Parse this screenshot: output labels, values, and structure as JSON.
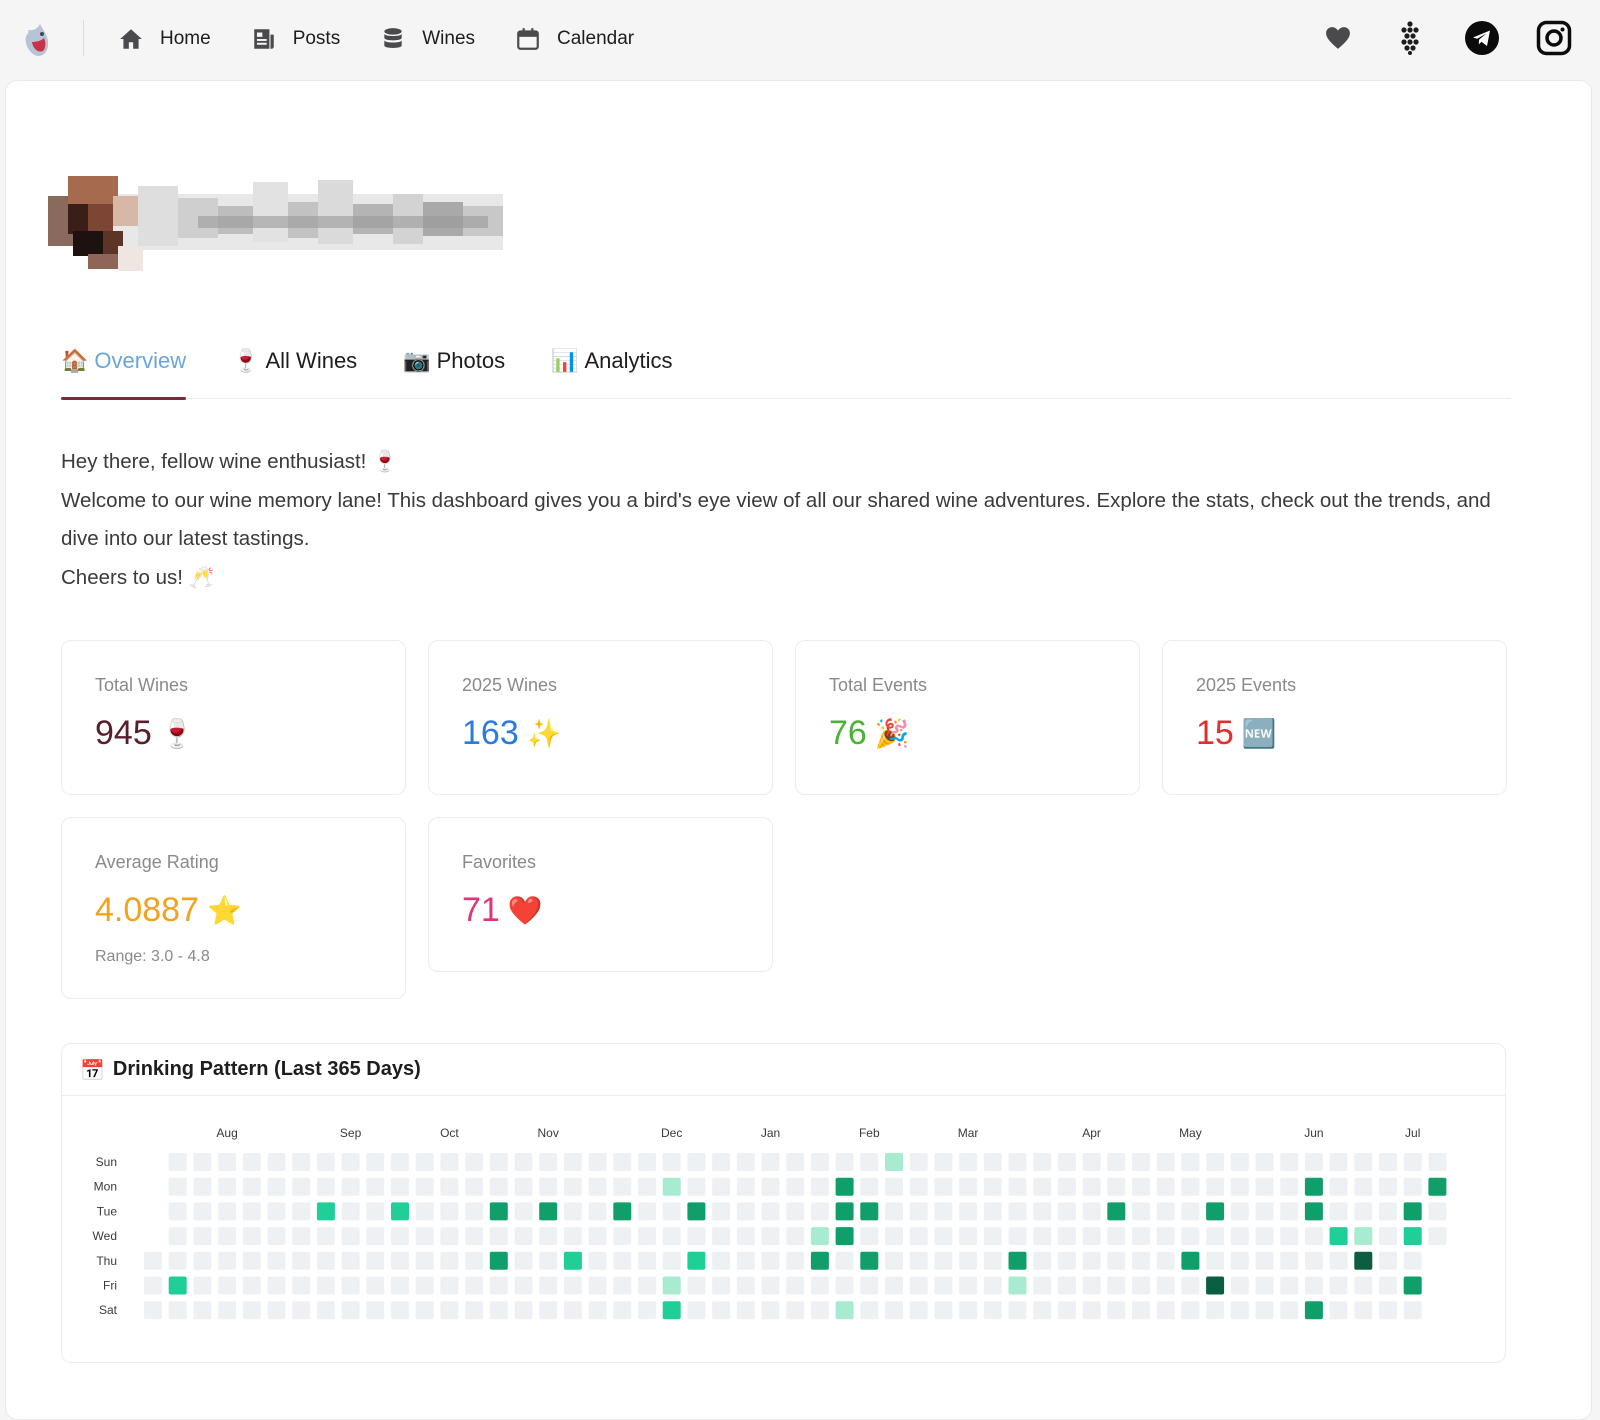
{
  "nav": {
    "links": [
      {
        "label": "Home",
        "icon": "home-icon"
      },
      {
        "label": "Posts",
        "icon": "posts-icon"
      },
      {
        "label": "Wines",
        "icon": "database-icon"
      },
      {
        "label": "Calendar",
        "icon": "calendar-icon"
      }
    ],
    "right_icons": [
      "heart-icon",
      "grapes-icon",
      "telegram-icon",
      "instagram-icon"
    ]
  },
  "tabs": [
    {
      "emoji": "🏠",
      "label": "Overview",
      "active": true
    },
    {
      "emoji": "🍷",
      "label": "All Wines",
      "active": false
    },
    {
      "emoji": "📷",
      "label": "Photos",
      "active": false
    },
    {
      "emoji": "📊",
      "label": "Analytics",
      "active": false
    }
  ],
  "intro": {
    "line1": "Hey there, fellow wine enthusiast! 🍷",
    "line2": "Welcome to our wine memory lane! This dashboard gives you a bird's eye view of all our shared wine adventures. Explore the stats, check out the trends, and dive into our latest tastings.",
    "line3": "Cheers to us! 🥂"
  },
  "stats": {
    "total_wines": {
      "label": "Total Wines",
      "value": "945",
      "emoji": "🍷",
      "color": "#5a1e2a"
    },
    "wines_2025": {
      "label": "2025 Wines",
      "value": "163",
      "emoji": "✨",
      "color": "#2a7be0"
    },
    "total_events": {
      "label": "Total Events",
      "value": "76",
      "emoji": "🎉",
      "color": "#4cb233"
    },
    "events_2025": {
      "label": "2025 Events",
      "value": "15",
      "emoji": "🆕",
      "color": "#e02f2f"
    },
    "avg_rating": {
      "label": "Average Rating",
      "value": "4.0887",
      "emoji": "⭐",
      "color": "#f2a21b",
      "range": "Range: 3.0 - 4.8"
    },
    "favorites": {
      "label": "Favorites",
      "value": "71",
      "emoji": "❤️",
      "color": "#e0357a"
    }
  },
  "heatmap": {
    "title": "Drinking Pattern (Last 365 Days)",
    "emoji": "📅",
    "day_labels": [
      "Sun",
      "Mon",
      "Tue",
      "Wed",
      "Thu",
      "Fri",
      "Sat"
    ],
    "months": [
      {
        "label": "Aug",
        "week": 3
      },
      {
        "label": "Sep",
        "week": 8
      },
      {
        "label": "Oct",
        "week": 12
      },
      {
        "label": "Nov",
        "week": 16
      },
      {
        "label": "Dec",
        "week": 21
      },
      {
        "label": "Jan",
        "week": 25
      },
      {
        "label": "Feb",
        "week": 29
      },
      {
        "label": "Mar",
        "week": 33
      },
      {
        "label": "Apr",
        "week": 38
      },
      {
        "label": "May",
        "week": 42
      },
      {
        "label": "Jun",
        "week": 47
      },
      {
        "label": "Jul",
        "week": 51
      }
    ],
    "weeks": 53,
    "colors": [
      "#eef1f4",
      "#a7ecd0",
      "#1fcf97",
      "#109e6a",
      "#0c5e41"
    ],
    "active_days": [
      {
        "week": 1,
        "day": 5,
        "level": 2
      },
      {
        "week": 7,
        "day": 2,
        "level": 2
      },
      {
        "week": 10,
        "day": 2,
        "level": 2
      },
      {
        "week": 14,
        "day": 2,
        "level": 3
      },
      {
        "week": 14,
        "day": 4,
        "level": 3
      },
      {
        "week": 16,
        "day": 2,
        "level": 3
      },
      {
        "week": 17,
        "day": 4,
        "level": 2
      },
      {
        "week": 19,
        "day": 2,
        "level": 3
      },
      {
        "week": 21,
        "day": 1,
        "level": 1
      },
      {
        "week": 21,
        "day": 5,
        "level": 1
      },
      {
        "week": 21,
        "day": 6,
        "level": 2
      },
      {
        "week": 22,
        "day": 2,
        "level": 3
      },
      {
        "week": 22,
        "day": 4,
        "level": 2
      },
      {
        "week": 27,
        "day": 3,
        "level": 1
      },
      {
        "week": 27,
        "day": 4,
        "level": 3
      },
      {
        "week": 28,
        "day": 1,
        "level": 3
      },
      {
        "week": 28,
        "day": 2,
        "level": 3
      },
      {
        "week": 28,
        "day": 3,
        "level": 3
      },
      {
        "week": 28,
        "day": 6,
        "level": 1
      },
      {
        "week": 29,
        "day": 2,
        "level": 3
      },
      {
        "week": 29,
        "day": 4,
        "level": 3
      },
      {
        "week": 30,
        "day": 0,
        "level": 1
      },
      {
        "week": 35,
        "day": 4,
        "level": 3
      },
      {
        "week": 35,
        "day": 5,
        "level": 1
      },
      {
        "week": 39,
        "day": 2,
        "level": 3
      },
      {
        "week": 42,
        "day": 4,
        "level": 3
      },
      {
        "week": 43,
        "day": 2,
        "level": 3
      },
      {
        "week": 43,
        "day": 5,
        "level": 4
      },
      {
        "week": 47,
        "day": 1,
        "level": 3
      },
      {
        "week": 47,
        "day": 2,
        "level": 3
      },
      {
        "week": 47,
        "day": 6,
        "level": 3
      },
      {
        "week": 48,
        "day": 3,
        "level": 2
      },
      {
        "week": 49,
        "day": 3,
        "level": 1
      },
      {
        "week": 49,
        "day": 4,
        "level": 4
      },
      {
        "week": 51,
        "day": 2,
        "level": 3
      },
      {
        "week": 51,
        "day": 3,
        "level": 2
      },
      {
        "week": 51,
        "day": 5,
        "level": 3
      },
      {
        "week": 52,
        "day": 1,
        "level": 3
      }
    ]
  }
}
